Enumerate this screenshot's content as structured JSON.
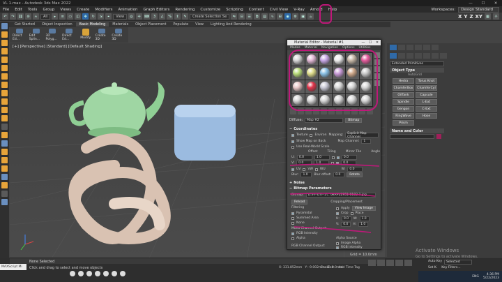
{
  "app": {
    "title": "VL 1.max - Autodesk 3ds Max 2022"
  },
  "menubar": {
    "items": [
      "File",
      "Edit",
      "Tools",
      "Group",
      "Views",
      "Create",
      "Modifiers",
      "Animation",
      "Graph Editors",
      "Rendering",
      "Customize",
      "Scripting",
      "Content",
      "Civil View",
      "V-Ray",
      "Arnold",
      "Help"
    ],
    "workspaces_label": "Workspaces:",
    "workspace_value": "Design Standard"
  },
  "toolbar": {
    "filter_value": "All",
    "view_value": "View",
    "selection_set_value": "Create Selection Se",
    "axis_labels": [
      "X",
      "Y",
      "Z",
      "XY"
    ]
  },
  "ribbon": {
    "tabs": [
      "Get Started",
      "Object Inspection",
      "Basic Modeling",
      "Materials",
      "Object Placement",
      "Populate",
      "View",
      "Lighting And Rendering"
    ],
    "active_tab": "Basic Modeling",
    "buttons": [
      "Direct Ed...",
      "Edit Splin...",
      "3D Polyg...",
      "Direct Ed...",
      "Modify",
      "Create 3D",
      "Create 3D"
    ]
  },
  "viewport": {
    "label": "[+] [Perspective] [Standard] [Default Shading]",
    "grid_label": "Grid = 10.0mm"
  },
  "material_editor": {
    "title": "Material Editor - Material #1",
    "menu": [
      "Modes",
      "Material",
      "Navigation",
      "Options",
      "Utilities"
    ],
    "slot_colors": [
      "#d6d6d6",
      "#e3b9d6",
      "#c8a7e6",
      "#eeeeee",
      "#c8b9a8",
      "#e45b9c",
      "#b9dd7a",
      "#dedb8a",
      "#8ac0e6",
      "#c89ad6",
      "#cfa88a",
      "#c8c8c8",
      "#e8c8c8",
      "#e0344a",
      "#c8c8d6",
      "#d6d6d6",
      "#d6d6d6",
      "#d6d6d6",
      "#d6d6d6",
      "#d6d6d6",
      "#d6d6d6",
      "#d6d6d6",
      "#d6d6d6",
      "#d6d6d6"
    ],
    "diffuse_label": "Diffuse:",
    "map_name": "Map #2",
    "bitmap_label": "Bitmap",
    "coordinates": {
      "header": "Coordinates",
      "texture_label": "Texture",
      "environ_label": "Environ",
      "mapping_label": "Mapping:",
      "mapping_value": "Explicit Map Channel",
      "show_map_label": "Show Map on Back",
      "map_channel_label": "Map Channel:",
      "map_channel_value": "1",
      "real_world_label": "Use Real-World Scale",
      "col_offset": "Offset",
      "col_tiling": "Tiling",
      "col_mirror_tile": "Mirror Tile",
      "col_angle": "Angle",
      "u_label": "U:",
      "v_label": "V:",
      "u_offset": "0.0",
      "v_offset": "0.0",
      "u_tiling": "1.0",
      "v_tiling": "1.0",
      "u_angle": "0.0",
      "v_angle": "0.0",
      "w_angle": "0.0",
      "uv_label": "UV",
      "vw_label": "VW",
      "wu_label": "WU",
      "w_label": "W:",
      "blur_label": "Blur:",
      "blur_value": "1.0",
      "blur_offset_label": "Blur offset:",
      "blur_offset_value": "0.0",
      "rotate_label": "Rotate"
    },
    "noise_header": "Noise",
    "bitmap_params": {
      "header": "Bitmap Parameters",
      "bitmap_label": "Bitmap:",
      "bitmap_path": "D:\\FF-DTF-2\\...\\MAP\\(2951-0102-1.jpg",
      "reload_label": "Reload",
      "cropping_label": "Cropping/Placement",
      "apply_label": "Apply",
      "view_image_label": "View Image",
      "crop_label": "Crop",
      "place_label": "Place",
      "filtering_label": "Filtering",
      "pyramidal_label": "Pyramidal",
      "summed_area_label": "Summed Area",
      "none_label": "None",
      "u_lbl": "U:",
      "v_lbl": "V:",
      "u_val": "0.0",
      "v_val": "0.0",
      "w_lbl": "W:",
      "h_lbl": "H:",
      "w_val": "1.0",
      "h_val": "1.0",
      "mono_output_label": "Mono Channel Output:",
      "rgb_intensity_label": "RGB Intensity",
      "alpha_label": "Alpha",
      "alpha_source_label": "Alpha Source",
      "image_alpha_label": "Image Alpha",
      "rgb_channel_output_label": "RGB Channel Output:",
      "rgb_intensity2_label": "RGB Intensity"
    }
  },
  "command_panel": {
    "category_value": "Extended Primitives",
    "object_type_header": "Object Type",
    "autogrid_label": "AutoGrid",
    "objects": [
      "Hedra",
      "Torus Knot",
      "ChamferBox",
      "ChamferCyl",
      "OilTank",
      "Capsule",
      "Spindle",
      "L-Ext",
      "Gengon",
      "C-Ext",
      "RingWave",
      "Hose",
      "Prism",
      ""
    ],
    "name_color_header": "Name and Color"
  },
  "status": {
    "maxscript_label": "MAXScript Mi",
    "none_selected": "None Selected",
    "instruction": "Click and drag to select and move objects",
    "x_value": "X: 331.852mm",
    "y_value": "Y: -9.002mm",
    "z_value": "Z: 0.0mm",
    "enabled_label": "Enabled:",
    "add_time_tag": "Add Time Tag",
    "auto_key_label": "Auto Key",
    "selected_label": "Selected",
    "set_key_label": "Set K.",
    "key_filters_label": "Key Filters..."
  },
  "activate": {
    "line1": "Activate Windows",
    "line2": "Go to Settings to activate Windows."
  },
  "taskbar": {
    "lang": "ENG",
    "time": "4:36 PM",
    "date": "5/22/2023"
  }
}
